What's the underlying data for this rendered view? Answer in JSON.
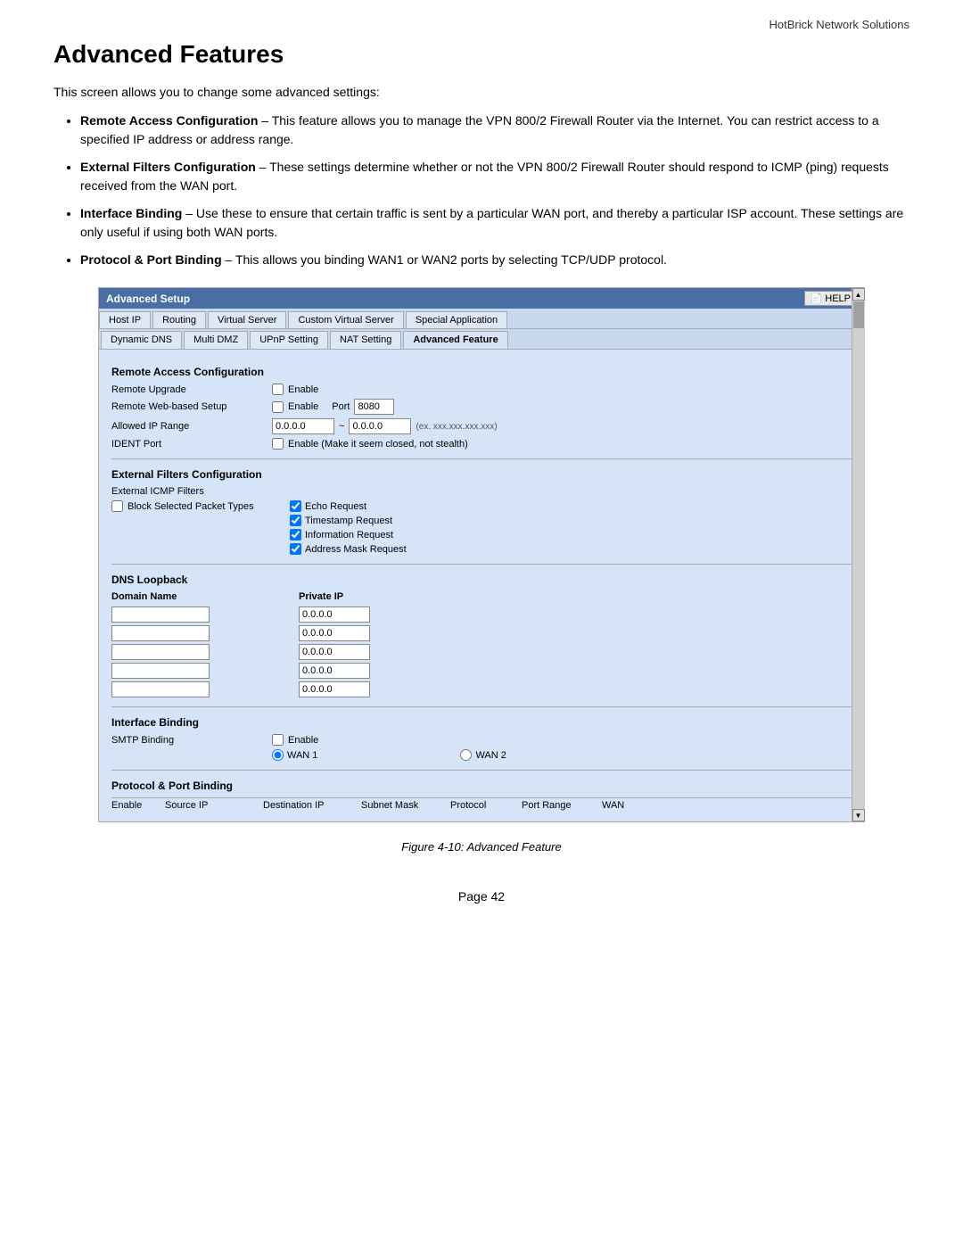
{
  "header": {
    "company": "HotBrick Network Solutions"
  },
  "page_title": "Advanced Features",
  "intro": "This screen allows you to change some advanced settings:",
  "bullets": [
    {
      "bold": "Remote Access Configuration",
      "text": " – This feature allows you to manage the VPN 800/2 Firewall Router via the Internet. You can restrict access to a specified IP address or address range."
    },
    {
      "bold": "External Filters Configuration",
      "text": " – These settings determine whether or not the VPN 800/2 Firewall Router should respond to ICMP (ping) requests received from the WAN port."
    },
    {
      "bold": "Interface Binding",
      "text": " – Use these to ensure that certain traffic is sent by a particular WAN port, and thereby a particular ISP account. These settings are only useful if using both WAN ports."
    },
    {
      "bold": "Protocol & Port Binding ",
      "text": " – This allows you binding WAN1 or WAN2 ports by selecting TCP/UDP protocol."
    }
  ],
  "panel": {
    "title": "Advanced Setup",
    "help_label": "HELP",
    "tabs_row1": [
      "Host IP",
      "Routing",
      "Virtual Server",
      "Custom Virtual Server",
      "Special Application"
    ],
    "tabs_row2": [
      "Dynamic DNS",
      "Multi DMZ",
      "UPnP Setting",
      "NAT Setting",
      "Advanced Feature"
    ],
    "active_tab1": "",
    "active_tab2": "Advanced Feature"
  },
  "sections": {
    "remote_access": {
      "title": "Remote Access Configuration",
      "fields": {
        "remote_upgrade_label": "Remote Upgrade",
        "remote_upgrade_checkbox": "Enable",
        "remote_web_label": "Remote Web-based Setup",
        "remote_web_checkbox": "Enable",
        "port_label": "Port",
        "port_value": "8080",
        "allowed_ip_label": "Allowed IP Range",
        "ip_from": "0.0.0.0",
        "tilde": "~",
        "ip_to": "0.0.0.0",
        "ip_hint": "(ex. xxx.xxx.xxx.xxx)",
        "ident_label": "IDENT Port",
        "ident_text": "Enable (Make it seem closed, not stealth)"
      }
    },
    "external_filters": {
      "title": "External Filters Configuration",
      "label": "External ICMP Filters",
      "block_label": "Block Selected Packet Types",
      "checkboxes": [
        {
          "label": "Echo Request",
          "checked": true
        },
        {
          "label": "Timestamp Request",
          "checked": true
        },
        {
          "label": "Information Request",
          "checked": true
        },
        {
          "label": "Address Mask Request",
          "checked": true
        }
      ]
    },
    "dns_loopback": {
      "title": "DNS Loopback",
      "domain_label": "Domain Name",
      "private_ip_label": "Private IP",
      "domain_rows": [
        "",
        "",
        "",
        "",
        ""
      ],
      "ip_rows": [
        "0.0.0.0",
        "0.0.0.0",
        "0.0.0.0",
        "0.0.0.0",
        "0.0.0.0"
      ]
    },
    "interface_binding": {
      "title": "Interface Binding",
      "smtp_label": "SMTP Binding",
      "enable_checkbox": "Enable",
      "wan1_label": "WAN 1",
      "wan2_label": "WAN 2"
    },
    "protocol_port": {
      "title": "Protocol & Port Binding",
      "columns": [
        "Enable",
        "Source IP",
        "Destination IP",
        "Subnet Mask",
        "Protocol",
        "Port Range",
        "WAN"
      ]
    }
  },
  "figure_caption": "Figure 4-10: Advanced Feature",
  "page_number": "Page 42"
}
